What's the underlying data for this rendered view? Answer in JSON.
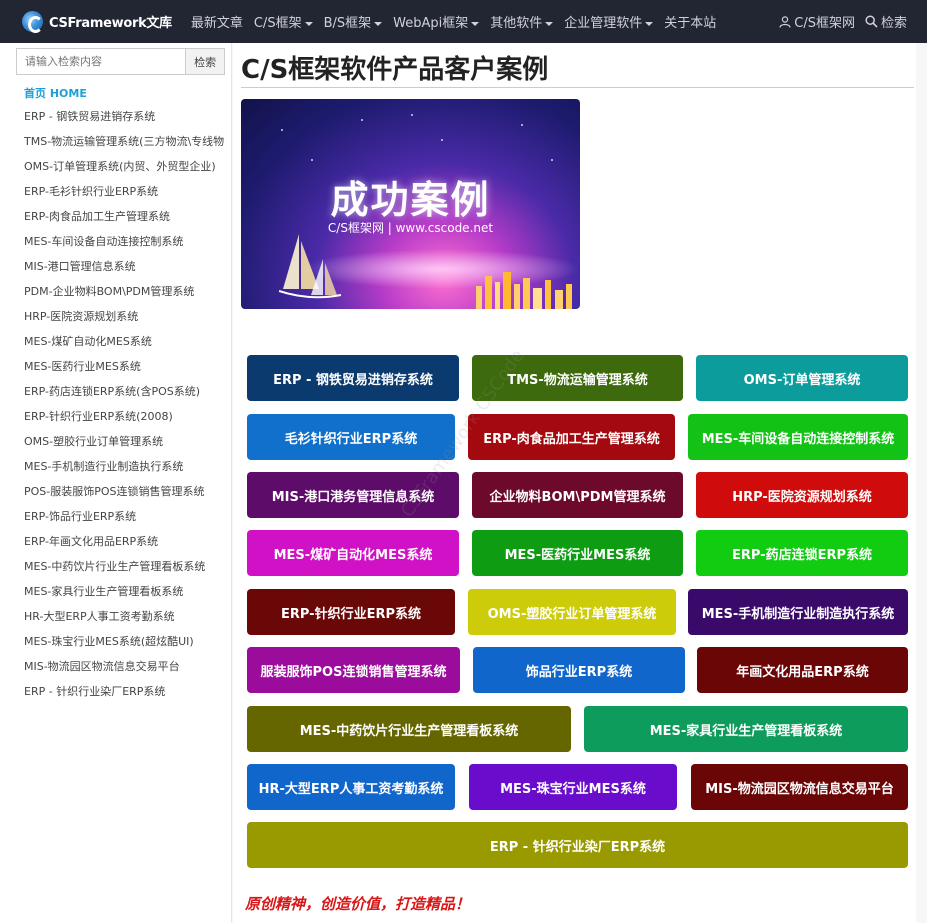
{
  "nav": {
    "brand": "CSFramework文库",
    "items": [
      {
        "label": "最新文章",
        "caret": false
      },
      {
        "label": "C/S框架",
        "caret": true
      },
      {
        "label": "B/S框架",
        "caret": true
      },
      {
        "label": "WebApi框架",
        "caret": true
      },
      {
        "label": "其他软件",
        "caret": true
      },
      {
        "label": "企业管理软件",
        "caret": true
      },
      {
        "label": "关于本站",
        "caret": false
      }
    ],
    "user_label": "C/S框架网",
    "search_label": "检索"
  },
  "sidebar": {
    "search_placeholder": "请输入检索内容",
    "search_button": "检索",
    "home": "首页 HOME",
    "items": [
      "ERP - 钢铁贸易进销存系统",
      "TMS-物流运输管理系统(三方物流\\专线物",
      "OMS-订单管理系统(内贸、外贸型企业)",
      "ERP-毛衫针织行业ERP系统",
      "ERP-肉食品加工生产管理系统",
      "MES-车间设备自动连接控制系统",
      "MIS-港口管理信息系统",
      "PDM-企业物料BOM\\PDM管理系统",
      "HRP-医院资源规划系统",
      "MES-煤矿自动化MES系统",
      "MES-医药行业MES系统",
      "ERP-药店连锁ERP系统(含POS系统)",
      "ERP-针织行业ERP系统(2008)",
      "OMS-塑胶行业订单管理系统",
      "MES-手机制造行业制造执行系统",
      "POS-服装服饰POS连锁销售管理系统",
      "ERP-饰品行业ERP系统",
      "ERP-年画文化用品ERP系统",
      "MES-中药饮片行业生产管理看板系统",
      "MES-家具行业生产管理看板系统",
      "HR-大型ERP人事工资考勤系统",
      "MES-珠宝行业MES系统(超炫酷UI)",
      "MIS-物流园区物流信息交易平台",
      "ERP - 针织行业染厂ERP系统"
    ]
  },
  "main": {
    "title": "C/S框架软件产品客户案例",
    "banner_title": "成功案例",
    "banner_sub": "C/S框架网 | www.cscode.net",
    "motto": "原创精神，创造价值，打造精品！",
    "buttons": [
      {
        "label": "ERP - 钢铁贸易进销存系统",
        "color": "#0b3a6e"
      },
      {
        "label": "TMS-物流运输管理系统",
        "color": "#3d6a0c"
      },
      {
        "label": "OMS-订单管理系统",
        "color": "#0d9c9c"
      },
      {
        "label": "毛衫针织行业ERP系统",
        "color": "#1170cc"
      },
      {
        "label": "ERP-肉食品加工生产管理系统",
        "color": "#a3090e"
      },
      {
        "label": "MES-车间设备自动连接控制系统",
        "color": "#12c215"
      },
      {
        "label": "MIS-港口港务管理信息系统",
        "color": "#5e0c6a"
      },
      {
        "label": "企业物料BOM\\PDM管理系统",
        "color": "#6d0a2c"
      },
      {
        "label": "HRP-医院资源规划系统",
        "color": "#cf0b0b"
      },
      {
        "label": "MES-煤矿自动化MES系统",
        "color": "#d011c6"
      },
      {
        "label": "MES-医药行业MES系统",
        "color": "#0e9c12"
      },
      {
        "label": "ERP-药店连锁ERP系统",
        "color": "#12cc12"
      },
      {
        "label": "ERP-针织行业ERP系统",
        "color": "#6a0808"
      },
      {
        "label": "OMS-塑胶行业订单管理系统",
        "color": "#cccc0a"
      },
      {
        "label": "MES-手机制造行业制造执行系统",
        "color": "#3a0a6a"
      },
      {
        "label": "服装服饰POS连锁销售管理系统",
        "color": "#9c0c9c"
      },
      {
        "label": "饰品行业ERP系统",
        "color": "#1166cc"
      },
      {
        "label": "年画文化用品ERP系统",
        "color": "#6a0606"
      },
      {
        "label": "MES-中药饮片行业生产管理看板系统",
        "color": "#666600"
      },
      {
        "label": "MES-家具行业生产管理看板系统",
        "color": "#0e9c5c"
      },
      {
        "label": "HR-大型ERP人事工资考勤系统",
        "color": "#1166cc"
      },
      {
        "label": "MES-珠宝行业MES系统",
        "color": "#6a0ccc"
      },
      {
        "label": "MIS-物流园区物流信息交易平台",
        "color": "#6a0606"
      },
      {
        "label": "ERP - 针织行业染厂ERP系统",
        "color": "#999900"
      }
    ]
  }
}
